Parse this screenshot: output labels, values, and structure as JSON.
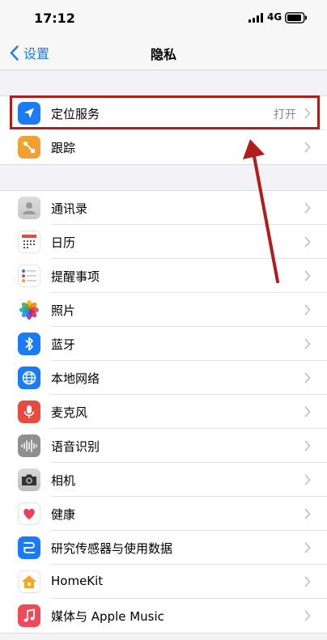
{
  "status_bar": {
    "time": "17:12",
    "network": "4G"
  },
  "nav": {
    "back_label": "设置",
    "title": "隐私"
  },
  "group1": [
    {
      "label": "定位服务",
      "value": "打开",
      "icon": "location-arrow-icon",
      "color": "#1a7cf5"
    },
    {
      "label": "跟踪",
      "icon": "tracking-icon",
      "color": "#f2a131"
    }
  ],
  "group2": [
    {
      "label": "通讯录",
      "icon": "contacts-icon"
    },
    {
      "label": "日历",
      "icon": "calendar-icon"
    },
    {
      "label": "提醒事项",
      "icon": "reminders-icon"
    },
    {
      "label": "照片",
      "icon": "photos-icon"
    },
    {
      "label": "蓝牙",
      "icon": "bluetooth-icon"
    },
    {
      "label": "本地网络",
      "icon": "globe-icon"
    },
    {
      "label": "麦克风",
      "icon": "microphone-icon"
    },
    {
      "label": "语音识别",
      "icon": "waveform-icon"
    },
    {
      "label": "相机",
      "icon": "camera-icon"
    },
    {
      "label": "健康",
      "icon": "heart-icon"
    },
    {
      "label": "研究传感器与使用数据",
      "icon": "research-icon"
    },
    {
      "label": "HomeKit",
      "icon": "home-icon"
    },
    {
      "label": "媒体与 Apple Music",
      "icon": "music-note-icon"
    }
  ],
  "colors": {
    "accent": "#1a7cf5",
    "highlight": "#b01d1d"
  }
}
